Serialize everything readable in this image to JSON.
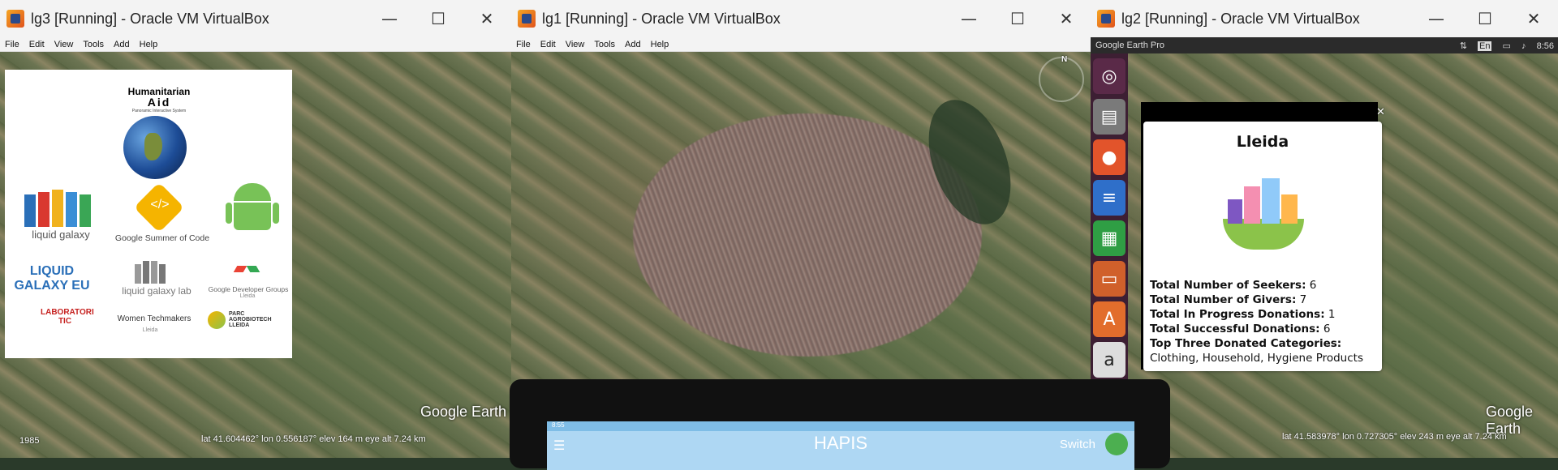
{
  "windows": {
    "lg3": {
      "title": "lg3 [Running] - Oracle VM VirtualBox",
      "menu": [
        "File",
        "Edit",
        "View",
        "Tools",
        "Add",
        "Help"
      ],
      "logo_panel": {
        "humanitarian": "Humanitarian",
        "aid": "Aid",
        "tagline": "Panoramic Interactive System",
        "liquid_galaxy": "liquid galaxy",
        "gsoc": "Google Summer of Code",
        "lg_eu": "LIQUID GALAXY EU",
        "lg_lab": "liquid galaxy lab",
        "gdg": "Google Developer Groups",
        "gdg_city": "Lleida",
        "lab_tic": "LABORATORI TIC",
        "women_tech": "Women Techmakers",
        "women_tech_city": "Lleida",
        "parc": "PARC AGROBIOTECH LLEIDA"
      },
      "google_earth": "Google Earth",
      "year": "1985",
      "status": "lat  41.604462°  lon  0.556187°  elev  164 m    eye alt  7.24 km"
    },
    "lg1": {
      "title": "lg1 [Running] - Oracle VM VirtualBox",
      "menu": [
        "File",
        "Edit",
        "View",
        "Tools",
        "Add",
        "Help"
      ],
      "compass": "N"
    },
    "lg2": {
      "title": "lg2 [Running] - Oracle VM VirtualBox",
      "app_name": "Google Earth Pro",
      "tray": {
        "lang": "En",
        "clock": "8:56"
      },
      "google_earth": "Google Earth",
      "status": "lat  41.583978°  lon  0.727305°  elev  243 m    eye alt  7.24 km"
    }
  },
  "info_card": {
    "city": "Lleida",
    "rows": [
      {
        "label": "Total Number of Seekers:",
        "value": "6"
      },
      {
        "label": "Total Number of Givers:",
        "value": "7"
      },
      {
        "label": "Total In Progress Donations:",
        "value": "1"
      },
      {
        "label": "Total Successful Donations:",
        "value": "6"
      },
      {
        "label": "Top Three Donated Categories:",
        "value": ""
      }
    ],
    "categories": "Clothing, Household, Hygiene Products"
  },
  "phone": {
    "status": "8:55",
    "app_title": "HAPIS",
    "switch_label": "Switch"
  },
  "window_controls": {
    "minimize": "—",
    "maximize": "☐",
    "close": "✕"
  }
}
